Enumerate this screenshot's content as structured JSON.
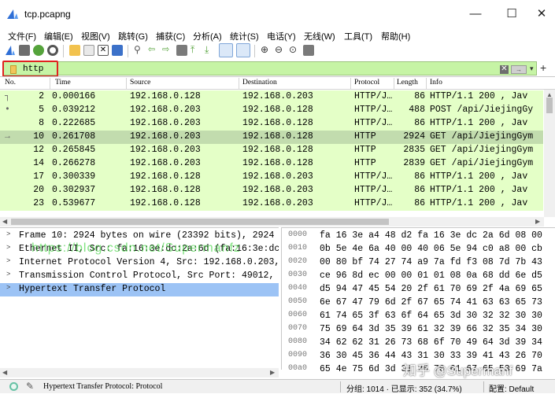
{
  "window": {
    "title": "tcp.pcapng",
    "minimize": "—",
    "maximize": "☐",
    "close": "✕"
  },
  "menu": [
    "文件(F)",
    "编辑(E)",
    "视图(V)",
    "跳转(G)",
    "捕获(C)",
    "分析(A)",
    "统计(S)",
    "电话(Y)",
    "无线(W)",
    "工具(T)",
    "帮助(H)"
  ],
  "toolbar": {
    "icons": [
      "shark-start-icon",
      "stop-icon",
      "restart-icon",
      "options-icon",
      "open-file-icon",
      "save-icon",
      "close-file-icon",
      "reload-icon",
      "find-icon",
      "back-icon",
      "forward-icon",
      "goto-icon",
      "first-icon",
      "last-icon",
      "autoscroll-icon",
      "colorize-icon",
      "zoom-in-icon",
      "zoom-out-icon",
      "zoom-reset-icon",
      "resize-columns-icon"
    ],
    "colors": {
      "shark": "#2f6fd6",
      "stop": "#6e6e6e",
      "folder": "#f2c24e",
      "green": "#55a33b",
      "blue": "#3c71c9",
      "gray": "#7a7a7a"
    }
  },
  "filter": {
    "value": "http",
    "clear": "✕",
    "apply": "→",
    "dropdown": "▾",
    "add": "+"
  },
  "packet_list": {
    "columns": [
      "No.",
      "Time",
      "Source",
      "Destination",
      "Protocol",
      "Length",
      "Info"
    ],
    "rows": [
      {
        "no": "2",
        "time": "0.000166",
        "src": "192.168.0.128",
        "dst": "192.168.0.203",
        "proto": "HTTP/J…",
        "len": "86",
        "info": "HTTP/1.1 200  , Jav",
        "selected": false,
        "marker": "┐"
      },
      {
        "no": "5",
        "time": "0.039212",
        "src": "192.168.0.203",
        "dst": "192.168.0.128",
        "proto": "HTTP/J…",
        "len": "488",
        "info": "POST /api/JiejingGy",
        "selected": false,
        "marker": "•"
      },
      {
        "no": "8",
        "time": "0.222685",
        "src": "192.168.0.203",
        "dst": "192.168.0.128",
        "proto": "HTTP/J…",
        "len": "86",
        "info": "HTTP/1.1 200  , Jav",
        "selected": false,
        "marker": ""
      },
      {
        "no": "10",
        "time": "0.261708",
        "src": "192.168.0.203",
        "dst": "192.168.0.128",
        "proto": "HTTP",
        "len": "2924",
        "info": "GET /api/JiejingGym",
        "selected": true,
        "marker": "→"
      },
      {
        "no": "12",
        "time": "0.265845",
        "src": "192.168.0.203",
        "dst": "192.168.0.128",
        "proto": "HTTP",
        "len": "2835",
        "info": "GET /api/JiejingGym",
        "selected": false,
        "marker": ""
      },
      {
        "no": "14",
        "time": "0.266278",
        "src": "192.168.0.203",
        "dst": "192.168.0.128",
        "proto": "HTTP",
        "len": "2839",
        "info": "GET /api/JiejingGym",
        "selected": false,
        "marker": ""
      },
      {
        "no": "17",
        "time": "0.300339",
        "src": "192.168.0.128",
        "dst": "192.168.0.203",
        "proto": "HTTP/J…",
        "len": "86",
        "info": "HTTP/1.1 200  , Jav",
        "selected": false,
        "marker": ""
      },
      {
        "no": "20",
        "time": "0.302937",
        "src": "192.168.0.128",
        "dst": "192.168.0.203",
        "proto": "HTTP/J…",
        "len": "86",
        "info": "HTTP/1.1 200  , Jav",
        "selected": false,
        "marker": ""
      },
      {
        "no": "23",
        "time": "0.539677",
        "src": "192.168.0.128",
        "dst": "192.168.0.203",
        "proto": "HTTP/J…",
        "len": "86",
        "info": "HTTP/1.1 200  , Jav",
        "selected": false,
        "marker": ""
      }
    ]
  },
  "details": {
    "rows": [
      {
        "text": "Frame 10: 2924 bytes on wire (23392 bits), 2924 b",
        "selected": false
      },
      {
        "text": "Ethernet II, Src: fa:16:3e:dc:2a:6d (fa:16:3e:dc",
        "selected": false
      },
      {
        "text": "Internet Protocol Version 4, Src: 192.168.0.203,",
        "selected": false
      },
      {
        "text": "Transmission Control Protocol, Src Port: 49012, D",
        "selected": false
      },
      {
        "text": "Hypertext Transfer Protocol",
        "selected": true
      }
    ]
  },
  "bytes": {
    "rows": [
      {
        "offset": "0000",
        "hex": "fa 16 3e a4 48 d2 fa 16  3e dc 2a 6d 08 00"
      },
      {
        "offset": "0010",
        "hex": "0b 5e 4e 6a 40 00 40 06  5e 94 c0 a8 00 cb"
      },
      {
        "offset": "0020",
        "hex": "00 80 bf 74 27 74 a9 7a  fd f3 08 7d 7b 43"
      },
      {
        "offset": "0030",
        "hex": "ce 96 8d ec 00 00 01 01  08 0a 68 dd 6e d5"
      },
      {
        "offset": "0040",
        "hex": "d5 94 47 45 54 20 2f 61  70 69 2f 4a 69 65"
      },
      {
        "offset": "0050",
        "hex": "6e 67 47 79 6d 2f 67 65  74 41 63 63 65 73"
      },
      {
        "offset": "0060",
        "hex": "61 74 65 3f 63 6f 64 65  3d 30 32 32 30 30"
      },
      {
        "offset": "0070",
        "hex": "75 69 64 3d 35 39 61 32  39 66 32 35 34 30"
      },
      {
        "offset": "0080",
        "hex": "34 62 62 31 26 73 68 6f  70 49 64 3d 39 34"
      },
      {
        "offset": "0090",
        "hex": "36 30 45 36 44 43 31 30  33 39 41 43 26 70"
      },
      {
        "offset": "00a0",
        "hex": "65 4e 75 6d 3d 31 26 70  61 67 65 53 69 7a"
      }
    ]
  },
  "watermarks": {
    "green": "https://blog.csdn.net/Supermanfz",
    "zhihu": "知乎 @Supermanf"
  },
  "status": {
    "field": "Hypertext Transfer Protocol: Protocol",
    "packets": "分组: 1014 · 已显示: 352 (34.7%)",
    "profile": "配置: Default"
  }
}
